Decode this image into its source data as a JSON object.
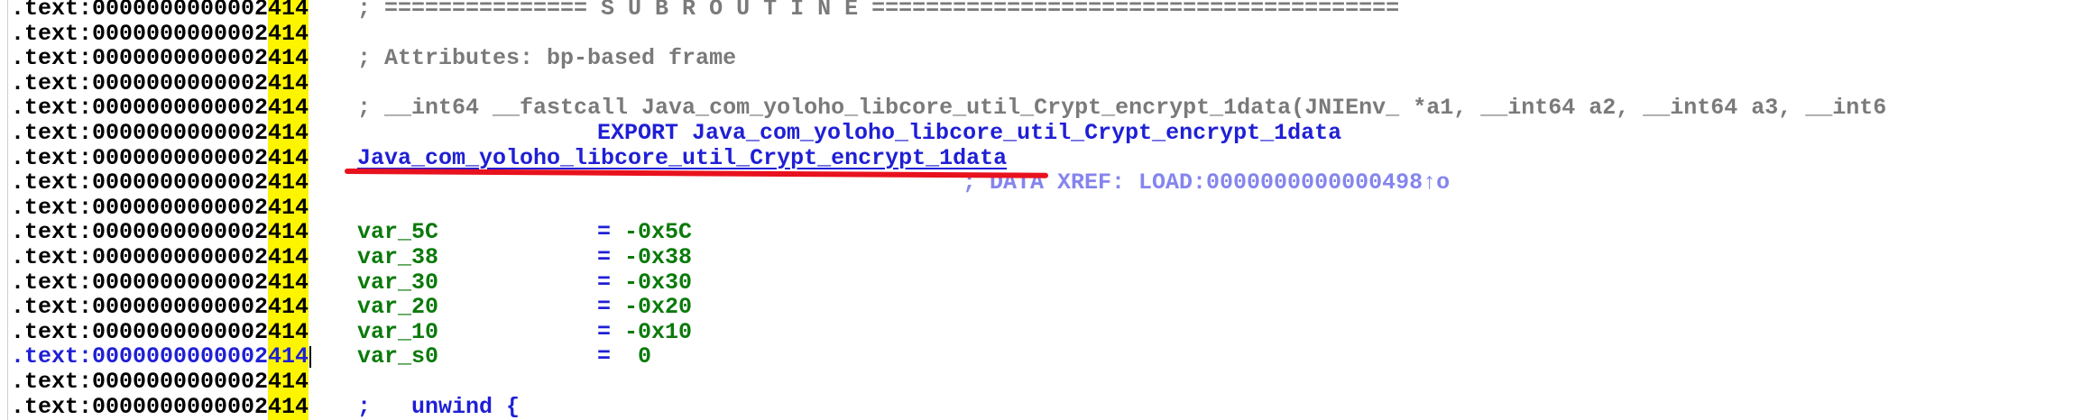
{
  "address": {
    "prefix": ".text:0000000000002",
    "highlight": "414"
  },
  "lines": [
    {
      "kind": "comment",
      "text": "; =============== S U B R O U T I N E ======================================="
    },
    {
      "kind": "blank",
      "text": ""
    },
    {
      "kind": "comment",
      "text": "; Attributes: bp-based frame"
    },
    {
      "kind": "blank",
      "text": ""
    },
    {
      "kind": "comment",
      "text": "; __int64 __fastcall Java_com_yoloho_libcore_util_Crypt_encrypt_1data(JNIEnv_ *a1, __int64 a2, __int64 a3, __int6"
    },
    {
      "kind": "export",
      "text": "EXPORT Java_com_yoloho_libcore_util_Crypt_encrypt_1data"
    },
    {
      "kind": "label",
      "text": "Java_com_yoloho_libcore_util_Crypt_encrypt_1data"
    },
    {
      "kind": "xref",
      "text": "; DATA XREF: LOAD:0000000000000498↑o"
    },
    {
      "kind": "blank",
      "text": ""
    },
    {
      "kind": "var",
      "name": "var_5C",
      "value": "= -0x5C"
    },
    {
      "kind": "var",
      "name": "var_38",
      "value": "= -0x38"
    },
    {
      "kind": "var",
      "name": "var_30",
      "value": "= -0x30"
    },
    {
      "kind": "var",
      "name": "var_20",
      "value": "= -0x20"
    },
    {
      "kind": "var",
      "name": "var_10",
      "value": "= -0x10"
    },
    {
      "kind": "var",
      "name": "var_s0",
      "value": "=  0",
      "current": true
    },
    {
      "kind": "blank",
      "text": ""
    },
    {
      "kind": "unwind",
      "text": ";   unwind {"
    }
  ],
  "colors": {
    "highlight": "#fdf500",
    "annotation_underline": "#e8121e",
    "name_blue": "#1f1fd6",
    "var_green": "#0b7a0b",
    "comment_gray": "#7a7a7a"
  }
}
